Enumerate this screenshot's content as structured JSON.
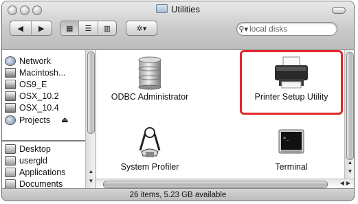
{
  "window": {
    "title": "Utilities"
  },
  "toolbar": {
    "back_label": "◀",
    "forward_label": "▶",
    "view_icon_label": "▦",
    "view_list_label": "☰",
    "view_column_label": "▥",
    "action_label": "✲▾"
  },
  "search": {
    "icon": "⚲▾",
    "value": "local disks"
  },
  "sidebar": {
    "items": [
      {
        "label": "Network",
        "icon": "network-icon"
      },
      {
        "label": "Macintosh...",
        "icon": "hard-drive-icon"
      },
      {
        "label": "OS9_E",
        "icon": "hard-drive-icon"
      },
      {
        "label": "OSX_10.2",
        "icon": "hard-drive-icon"
      },
      {
        "label": "OSX_10.4",
        "icon": "hard-drive-icon"
      },
      {
        "label": "Projects",
        "icon": "network-volume-icon",
        "eject": "⏏"
      },
      {
        "label": "Desktop",
        "icon": "desktop-icon"
      },
      {
        "label": "usergld",
        "icon": "home-icon"
      },
      {
        "label": "Applications",
        "icon": "applications-icon"
      },
      {
        "label": "Documents",
        "icon": "documents-icon"
      }
    ]
  },
  "main": {
    "items": [
      {
        "label": "ODBC Administrator",
        "icon": "odbc-icon"
      },
      {
        "label": "Printer Setup Utility",
        "icon": "printer-icon",
        "highlighted": true
      },
      {
        "label": "System Profiler",
        "icon": "system-profiler-icon"
      },
      {
        "label": "Terminal",
        "icon": "terminal-icon"
      }
    ]
  },
  "status": {
    "text": "26 items, 5.23 GB available"
  },
  "colors": {
    "highlight": "#e1262c"
  }
}
